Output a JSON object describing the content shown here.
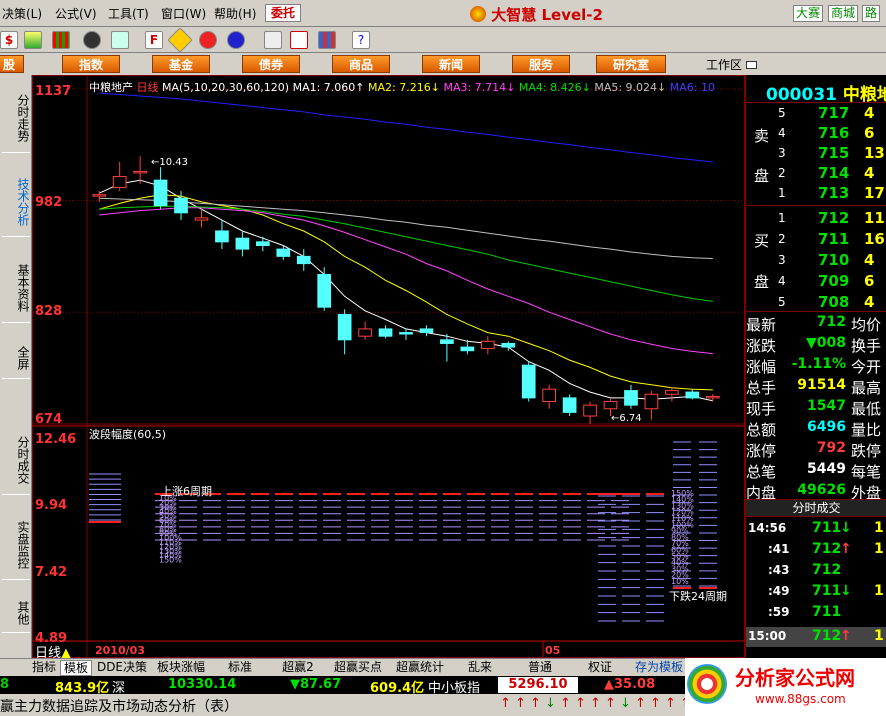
{
  "menubar": {
    "items": [
      "决策(L)",
      "公式(V)",
      "工具(T)",
      "窗口(W)",
      "帮助(H)"
    ],
    "entrust_label": "委托",
    "brand": "大智慧",
    "brand_level": "Level-2",
    "right_buttons": [
      "大赛",
      "商城",
      "路"
    ]
  },
  "catbar": {
    "items": [
      "股",
      "指数",
      "基金",
      "债券",
      "商品",
      "新闻",
      "服务",
      "研究室"
    ],
    "workzone_label": "工作区"
  },
  "sidetabs": [
    "分时走势",
    "技术分析",
    "基本资料",
    "全屏",
    "分时成交",
    "实盘监控",
    "其他"
  ],
  "chart": {
    "header": {
      "stock_name": "中粮地产",
      "period": "日线",
      "ma_def": "MA(5,10,20,30,60,120)",
      "ma1": "MA1: 7.060↑",
      "ma2": "MA2: 7.216↓",
      "ma3": "MA3: 7.714↓",
      "ma4": "MA4: 8.426↓",
      "ma5": "MA5: 9.024↓",
      "ma6": "MA6: 10"
    },
    "y_labels": [
      "1137",
      "982",
      "828",
      "674"
    ],
    "max_annot": "10.43",
    "min_annot": "6.74",
    "lower": {
      "title": "波段幅度(60,5)",
      "y_labels": [
        "12.46",
        "9.94",
        "7.42",
        "4.89"
      ],
      "up_label": "上涨6周期",
      "down_label": "下跌24周期",
      "up_pcts": [
        "10%",
        "20%",
        "30%",
        "40%",
        "50%",
        "60%",
        "70%",
        "80%",
        "90%",
        "100%",
        "110%",
        "120%",
        "130%",
        "140%",
        "150%"
      ],
      "down_pcts": [
        "10%",
        "20%",
        "30%",
        "40%",
        "50%",
        "60%",
        "70%",
        "80%",
        "90%",
        "100%",
        "110%",
        "120%",
        "130%",
        "140%",
        "150%"
      ]
    },
    "footer_label": "日线",
    "x_labels": [
      "2010/03",
      "05"
    ]
  },
  "chart_data": {
    "type": "candlestick",
    "title": "中粮地产 日线",
    "ylim": [
      6.74,
      11.37
    ],
    "candles": [
      {
        "o": 9.88,
        "h": 9.95,
        "l": 9.8,
        "c": 9.9
      },
      {
        "o": 10.0,
        "h": 10.35,
        "l": 9.95,
        "c": 10.15
      },
      {
        "o": 10.2,
        "h": 10.43,
        "l": 10.05,
        "c": 10.22
      },
      {
        "o": 10.1,
        "h": 10.28,
        "l": 9.7,
        "c": 9.75
      },
      {
        "o": 9.85,
        "h": 9.95,
        "l": 9.55,
        "c": 9.65
      },
      {
        "o": 9.55,
        "h": 9.7,
        "l": 9.45,
        "c": 9.58
      },
      {
        "o": 9.4,
        "h": 9.55,
        "l": 9.15,
        "c": 9.25
      },
      {
        "o": 9.3,
        "h": 9.4,
        "l": 9.05,
        "c": 9.15
      },
      {
        "o": 9.25,
        "h": 9.32,
        "l": 9.12,
        "c": 9.2
      },
      {
        "o": 9.15,
        "h": 9.2,
        "l": 9.0,
        "c": 9.05
      },
      {
        "o": 9.05,
        "h": 9.15,
        "l": 8.85,
        "c": 8.95
      },
      {
        "o": 8.8,
        "h": 8.9,
        "l": 8.3,
        "c": 8.35
      },
      {
        "o": 8.25,
        "h": 8.32,
        "l": 7.7,
        "c": 7.9
      },
      {
        "o": 7.95,
        "h": 8.15,
        "l": 7.9,
        "c": 8.05
      },
      {
        "o": 8.05,
        "h": 8.1,
        "l": 7.92,
        "c": 7.95
      },
      {
        "o": 8.0,
        "h": 8.05,
        "l": 7.9,
        "c": 7.98
      },
      {
        "o": 8.05,
        "h": 8.1,
        "l": 7.95,
        "c": 8.0
      },
      {
        "o": 7.9,
        "h": 7.98,
        "l": 7.6,
        "c": 7.85
      },
      {
        "o": 7.8,
        "h": 7.9,
        "l": 7.7,
        "c": 7.75
      },
      {
        "o": 7.78,
        "h": 7.95,
        "l": 7.7,
        "c": 7.88
      },
      {
        "o": 7.85,
        "h": 7.88,
        "l": 7.75,
        "c": 7.8
      },
      {
        "o": 7.55,
        "h": 7.6,
        "l": 7.05,
        "c": 7.1
      },
      {
        "o": 7.05,
        "h": 7.28,
        "l": 6.95,
        "c": 7.22
      },
      {
        "o": 7.1,
        "h": 7.15,
        "l": 6.85,
        "c": 6.9
      },
      {
        "o": 6.85,
        "h": 7.05,
        "l": 6.74,
        "c": 7.0
      },
      {
        "o": 6.95,
        "h": 7.1,
        "l": 6.85,
        "c": 7.05
      },
      {
        "o": 7.2,
        "h": 7.28,
        "l": 6.95,
        "c": 7.0
      },
      {
        "o": 6.95,
        "h": 7.2,
        "l": 6.8,
        "c": 7.15
      },
      {
        "o": 7.15,
        "h": 7.25,
        "l": 7.05,
        "c": 7.2
      },
      {
        "o": 7.18,
        "h": 7.22,
        "l": 7.08,
        "c": 7.1
      },
      {
        "o": 7.1,
        "h": 7.15,
        "l": 7.05,
        "c": 7.12
      }
    ],
    "ma_lines": [
      {
        "name": "MA5",
        "color": "#ffffff",
        "values": [
          9.92,
          10.05,
          10.1,
          10.02,
          9.85,
          9.7,
          9.55,
          9.4,
          9.3,
          9.2,
          9.05,
          8.8,
          8.5,
          8.3,
          8.18,
          8.05,
          8.0,
          7.95,
          7.88,
          7.85,
          7.8,
          7.6,
          7.48,
          7.3,
          7.18,
          7.1,
          7.1,
          7.08,
          7.1,
          7.12,
          7.06
        ]
      },
      {
        "name": "MA10",
        "color": "#ffff00",
        "values": [
          9.7,
          9.78,
          9.85,
          9.9,
          9.88,
          9.8,
          9.75,
          9.7,
          9.62,
          9.5,
          9.4,
          9.25,
          9.05,
          8.9,
          8.72,
          8.58,
          8.42,
          8.25,
          8.12,
          8.0,
          7.95,
          7.85,
          7.75,
          7.62,
          7.52,
          7.4,
          7.32,
          7.28,
          7.24,
          7.22,
          7.21
        ]
      },
      {
        "name": "MA20",
        "color": "#ff44ff",
        "values": [
          9.62,
          9.65,
          9.68,
          9.7,
          9.72,
          9.72,
          9.7,
          9.68,
          9.65,
          9.6,
          9.55,
          9.47,
          9.38,
          9.28,
          9.18,
          9.08,
          8.95,
          8.85,
          8.72,
          8.6,
          8.5,
          8.4,
          8.28,
          8.18,
          8.08,
          7.98,
          7.9,
          7.84,
          7.78,
          7.74,
          7.71
        ]
      },
      {
        "name": "MA30",
        "color": "#00cc00",
        "values": [
          9.7,
          9.72,
          9.73,
          9.74,
          9.74,
          9.73,
          9.72,
          9.7,
          9.67,
          9.63,
          9.6,
          9.55,
          9.5,
          9.44,
          9.38,
          9.32,
          9.26,
          9.2,
          9.14,
          9.08,
          9.0,
          8.94,
          8.88,
          8.82,
          8.76,
          8.7,
          8.64,
          8.58,
          8.52,
          8.47,
          8.43
        ]
      },
      {
        "name": "MA60",
        "color": "#c0c0c0",
        "values": [
          9.85,
          9.84,
          9.83,
          9.82,
          9.8,
          9.78,
          9.76,
          9.74,
          9.72,
          9.7,
          9.68,
          9.65,
          9.62,
          9.59,
          9.55,
          9.52,
          9.48,
          9.45,
          9.41,
          9.37,
          9.33,
          9.29,
          9.26,
          9.22,
          9.18,
          9.15,
          9.11,
          9.08,
          9.05,
          9.03,
          9.02
        ]
      },
      {
        "name": "MA120",
        "color": "#2020ff",
        "values": [
          11.3,
          11.28,
          11.26,
          11.24,
          11.22,
          11.19,
          11.16,
          11.13,
          11.1,
          11.07,
          11.04,
          11.0,
          10.97,
          10.94,
          10.9,
          10.87,
          10.83,
          10.8,
          10.76,
          10.73,
          10.69,
          10.66,
          10.62,
          10.59,
          10.55,
          10.52,
          10.48,
          10.45,
          10.41,
          10.38,
          10.35
        ]
      }
    ]
  },
  "quote": {
    "code": "000031",
    "name": "中粮地",
    "sell_label_1": "卖",
    "sell_label_2": "盘",
    "buy_label_1": "买",
    "buy_label_2": "盘",
    "sell": [
      {
        "lvl": "5",
        "price": "717",
        "vol": "4"
      },
      {
        "lvl": "4",
        "price": "716",
        "vol": "6"
      },
      {
        "lvl": "3",
        "price": "715",
        "vol": "13"
      },
      {
        "lvl": "2",
        "price": "714",
        "vol": "4"
      },
      {
        "lvl": "1",
        "price": "713",
        "vol": "17"
      }
    ],
    "buy": [
      {
        "lvl": "1",
        "price": "712",
        "vol": "11"
      },
      {
        "lvl": "2",
        "price": "711",
        "vol": "16"
      },
      {
        "lvl": "3",
        "price": "710",
        "vol": "4"
      },
      {
        "lvl": "4",
        "price": "709",
        "vol": "6"
      },
      {
        "lvl": "5",
        "price": "708",
        "vol": "4"
      }
    ],
    "stats": [
      {
        "k": "最新",
        "v": "712",
        "c": "green",
        "k2": "均价"
      },
      {
        "k": "涨跌",
        "v": "▼008",
        "c": "green",
        "k2": "换手"
      },
      {
        "k": "涨幅",
        "v": "-1.11%",
        "c": "green",
        "k2": "今开"
      },
      {
        "k": "总手",
        "v": "91514",
        "c": "yel",
        "k2": "最高"
      },
      {
        "k": "现手",
        "v": "1547",
        "c": "green",
        "k2": "最低"
      },
      {
        "k": "总额",
        "v": "6496",
        "c": "cyan",
        "k2": "量比"
      },
      {
        "k": "涨停",
        "v": "792",
        "c": "red",
        "k2": "跌停"
      },
      {
        "k": "总笔",
        "v": "5449",
        "c": "white",
        "k2": "每笔"
      },
      {
        "k": "内盘",
        "v": "49626",
        "c": "green",
        "k2": "外盘"
      }
    ],
    "ticks_title": "分时成交",
    "ticks": [
      {
        "t": "14:56",
        "p": "711",
        "d": "↓",
        "c": "green",
        "v": "1"
      },
      {
        "t": ":41",
        "p": "712",
        "d": "↑",
        "c": "green",
        "v": "1"
      },
      {
        "t": ":43",
        "p": "712",
        "d": "",
        "c": "green",
        "v": ""
      },
      {
        "t": ":49",
        "p": "711",
        "d": "↓",
        "c": "green",
        "v": "1"
      },
      {
        "t": ":59",
        "p": "711",
        "d": "",
        "c": "green",
        "v": ""
      },
      {
        "t": "15:00",
        "p": "712",
        "d": "↑",
        "c": "green",
        "v": "1"
      }
    ]
  },
  "bottom_tabs": [
    "指标",
    "模板",
    "DDE决策",
    "板块涨幅",
    "标准",
    "超赢2",
    "超赢买点",
    "超赢统计",
    "乱来",
    "普通",
    "权证",
    "存为模板"
  ],
  "index_bar": {
    "v1": "843.9亿",
    "l1": "深",
    "v2": "10330.14",
    "v3": "▼87.67",
    "v4": "609.4亿",
    "l2": "中小板指",
    "v5": "5296.10",
    "v6": "▲35.08"
  },
  "status": {
    "text": "赢主力数据追踪及市场动态分析（表）"
  },
  "watermark": {
    "title": "分析家公式网",
    "url": "www.88gs.com"
  }
}
